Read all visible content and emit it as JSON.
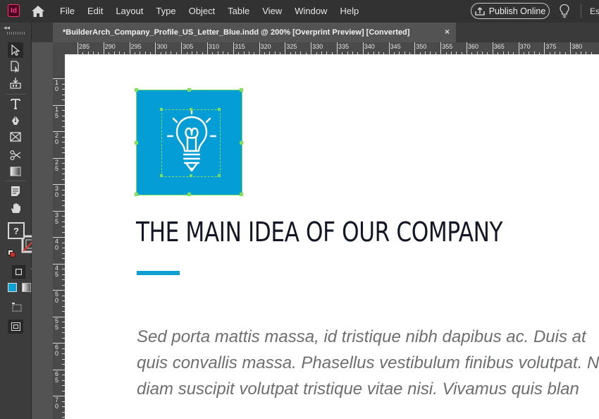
{
  "app": {
    "icon_label": "Id",
    "menu": [
      "File",
      "Edit",
      "Layout",
      "Type",
      "Object",
      "Table",
      "View",
      "Window",
      "Help"
    ],
    "publish_label": "Publish Online",
    "search_fragment": "Es"
  },
  "document": {
    "tab_title": "*BuilderArch_Company_Profile_US_Letter_Blue.indd @ 200% [Overprint Preview] [Converted]",
    "close_glyph": "×"
  },
  "rulers": {
    "horizontal": [
      "285",
      "290",
      "295",
      "300",
      "305",
      "310",
      "315",
      "320",
      "325",
      "330",
      "335",
      "340",
      "345",
      "350",
      "355",
      "360",
      "365",
      "370",
      "375",
      "380"
    ],
    "vertical": [
      "1\n0",
      "1\n5",
      "2\n0",
      "2\n5",
      "3\n0",
      "3\n5",
      "4\n0",
      "4\n5",
      "5\n0",
      "5\n5",
      "6\n0",
      "6\n5",
      "7\n0"
    ]
  },
  "tools": {
    "fill_label": "?",
    "swap_glyph": "↶",
    "formatting_text_glyph": "T",
    "icons": [
      "selection-tool-icon",
      "direct-selection-tool-icon",
      "page-tool-icon",
      "gap-tool-icon",
      "content-collector-icon",
      "content-placer-icon",
      "type-tool-icon",
      "line-tool-icon",
      "pen-tool-icon",
      "pencil-tool-icon",
      "rectangle-frame-tool-icon",
      "rectangle-tool-icon",
      "scissors-tool-icon",
      "free-transform-tool-icon",
      "gradient-swatch-tool-icon",
      "gradient-feather-tool-icon",
      "note-tool-icon",
      "eyedropper-tool-icon",
      "hand-tool-icon",
      "zoom-tool-icon"
    ]
  },
  "page": {
    "headline": "THE MAIN IDEA OF OUR COMPANY",
    "body_lines": [
      "Sed porta mattis massa, id tristique nibh dapibus ac. Duis at",
      "quis convallis massa. Phasellus vestibulum finibus volutpat. N",
      "diam suscipit volutpat tristique vitae nisi. Vivamus quis blan"
    ]
  },
  "colors": {
    "frame_blue": "#059dd6",
    "accent_rule": "#0e9fd3",
    "selection_green": "#7ddf5c",
    "headline": "#131725",
    "body_text": "#6d6e70"
  }
}
